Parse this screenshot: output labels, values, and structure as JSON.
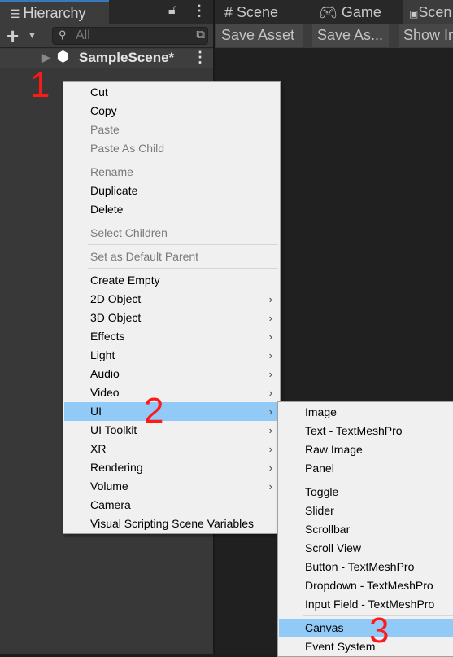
{
  "hierarchy": {
    "title": "Hierarchy",
    "search_placeholder": "All",
    "scene": "SampleScene*"
  },
  "tabs": [
    {
      "label": "Scene"
    },
    {
      "label": "Game"
    },
    {
      "label": "Scen"
    }
  ],
  "toolbar": [
    "Save Asset",
    "Save As...",
    "Show In"
  ],
  "context_menu": [
    {
      "label": "Cut"
    },
    {
      "label": "Copy"
    },
    {
      "label": "Paste",
      "disabled": true
    },
    {
      "label": "Paste As Child",
      "disabled": true
    },
    {
      "sep": true
    },
    {
      "label": "Rename",
      "disabled": true
    },
    {
      "label": "Duplicate"
    },
    {
      "label": "Delete"
    },
    {
      "sep": true
    },
    {
      "label": "Select Children",
      "disabled": true
    },
    {
      "sep": true
    },
    {
      "label": "Set as Default Parent",
      "disabled": true
    },
    {
      "sep": true
    },
    {
      "label": "Create Empty"
    },
    {
      "label": "2D Object",
      "sub": true
    },
    {
      "label": "3D Object",
      "sub": true
    },
    {
      "label": "Effects",
      "sub": true
    },
    {
      "label": "Light",
      "sub": true
    },
    {
      "label": "Audio",
      "sub": true
    },
    {
      "label": "Video",
      "sub": true
    },
    {
      "label": "UI",
      "sub": true,
      "highlighted": true
    },
    {
      "label": "UI Toolkit",
      "sub": true
    },
    {
      "label": "XR",
      "sub": true
    },
    {
      "label": "Rendering",
      "sub": true
    },
    {
      "label": "Volume",
      "sub": true
    },
    {
      "label": "Camera"
    },
    {
      "label": "Visual Scripting Scene Variables"
    }
  ],
  "ui_submenu": [
    {
      "label": "Image"
    },
    {
      "label": "Text - TextMeshPro"
    },
    {
      "label": "Raw Image"
    },
    {
      "label": "Panel"
    },
    {
      "sep": true
    },
    {
      "label": "Toggle"
    },
    {
      "label": "Slider"
    },
    {
      "label": "Scrollbar"
    },
    {
      "label": "Scroll View"
    },
    {
      "label": "Button - TextMeshPro"
    },
    {
      "label": "Dropdown - TextMeshPro"
    },
    {
      "label": "Input Field - TextMeshPro"
    },
    {
      "sep": true
    },
    {
      "label": "Canvas",
      "highlighted": true
    },
    {
      "label": "Event System"
    }
  ],
  "annotations": [
    "1",
    "2",
    "3"
  ],
  "colors": {
    "highlight": "#91c9f7",
    "annotation": "#ff1a1a",
    "tab_accent": "#3a79bb"
  }
}
